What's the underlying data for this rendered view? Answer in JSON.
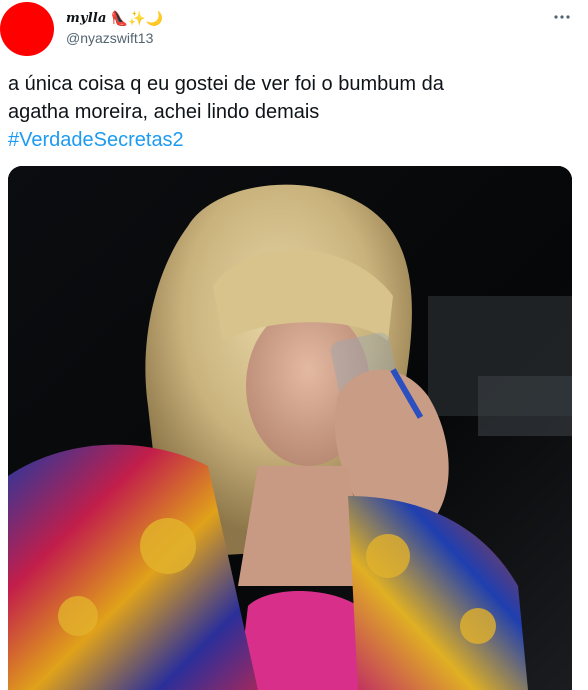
{
  "user": {
    "display_name": "mylla",
    "name_emojis": "👠✨🌙",
    "handle": "@nyazswift13",
    "avatar_color": "#ff0000"
  },
  "tweet": {
    "text_line1": "a única coisa q eu gostei de ver foi o bumbum da",
    "text_line2": "agatha moreira, achei lindo demais",
    "hashtag": "#VerdadeSecretas2"
  },
  "actions": {
    "more_icon": "more-horizontal-icon"
  },
  "colors": {
    "link": "#1d9bf0",
    "text": "#0f1419",
    "secondary": "#536471"
  }
}
